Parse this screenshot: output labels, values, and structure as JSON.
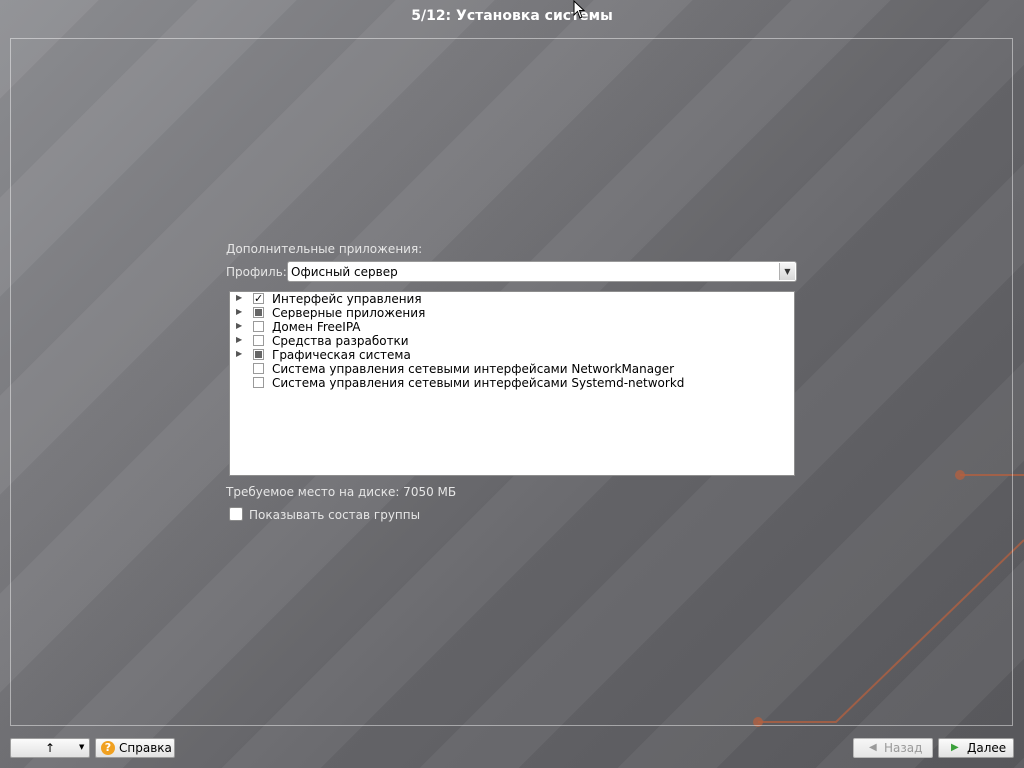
{
  "window": {
    "title": "5/12: Установка системы"
  },
  "content": {
    "apps_label": "Дополнительные приложения:",
    "profile_label": "Профиль:",
    "profile_value": "Офисный сервер",
    "groups": [
      {
        "label": "Интерфейс управления",
        "expandable": true,
        "state": "checked",
        "mark": "✓"
      },
      {
        "label": "Серверные приложения",
        "expandable": true,
        "state": "partial",
        "mark": ""
      },
      {
        "label": "Домен FreeIPA",
        "expandable": true,
        "state": "unchecked",
        "mark": ""
      },
      {
        "label": "Средства разработки",
        "expandable": true,
        "state": "unchecked",
        "mark": ""
      },
      {
        "label": "Графическая система",
        "expandable": true,
        "state": "partial",
        "mark": ""
      },
      {
        "label": "Система управления сетевыми интерфейсами NetworkManager",
        "expandable": false,
        "state": "unchecked",
        "mark": ""
      },
      {
        "label": "Система управления сетевыми интерфейсами Systemd-networkd",
        "expandable": false,
        "state": "unchecked",
        "mark": ""
      }
    ],
    "disk_space": "Требуемое место на диске: 7050 МБ",
    "show_group_label": "Показывать состав группы"
  },
  "footer": {
    "help_label": "Справка",
    "back_label": "Назад",
    "next_label": "Далее"
  },
  "colors": {
    "accent_line": "#b5603f",
    "help_icon": "#f0a020",
    "next_arrow": "#3aa03a"
  },
  "icons": {
    "up_arrow": "up-arrow-icon",
    "dropdown": "chevron-down-icon",
    "help": "help-icon",
    "back": "back-arrow-icon",
    "next": "next-arrow-icon",
    "expander": "expander-icon",
    "cursor": "mouse-cursor-icon"
  }
}
